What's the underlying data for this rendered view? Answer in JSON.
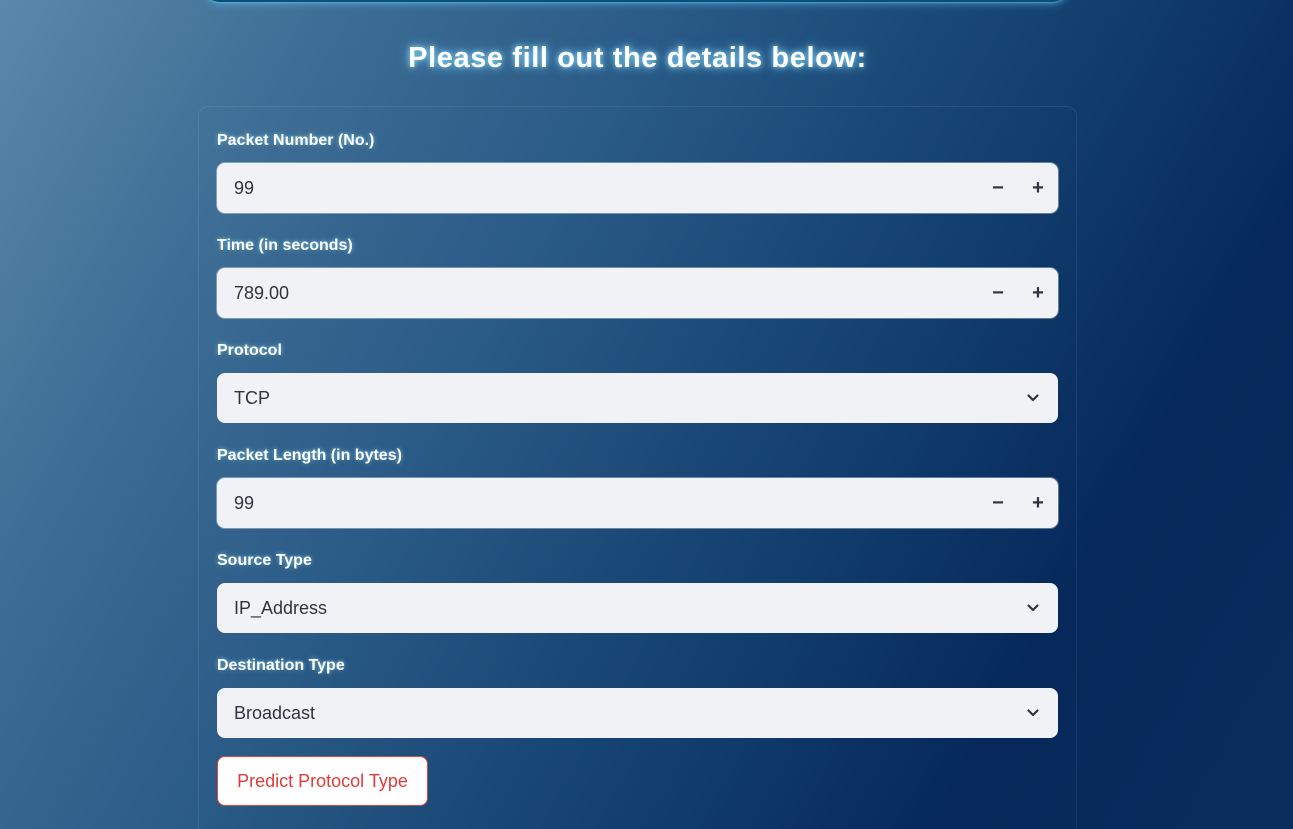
{
  "heading": "Please fill out the details below:",
  "fields": {
    "packet_number": {
      "label": "Packet Number (No.)",
      "value": "99"
    },
    "time": {
      "label": "Time (in seconds)",
      "value": "789.00"
    },
    "protocol": {
      "label": "Protocol",
      "value": "TCP"
    },
    "packet_length": {
      "label": "Packet Length (in bytes)",
      "value": "99"
    },
    "source_type": {
      "label": "Source Type",
      "value": "IP_Address"
    },
    "destination_type": {
      "label": "Destination Type",
      "value": "Broadcast"
    }
  },
  "stepper": {
    "minus": "−",
    "plus": "+"
  },
  "predict_button": "Predict Protocol Type",
  "colors": {
    "button_accent": "#e03b3b",
    "input_bg": "#f0f2f6",
    "text": "#31333f"
  }
}
